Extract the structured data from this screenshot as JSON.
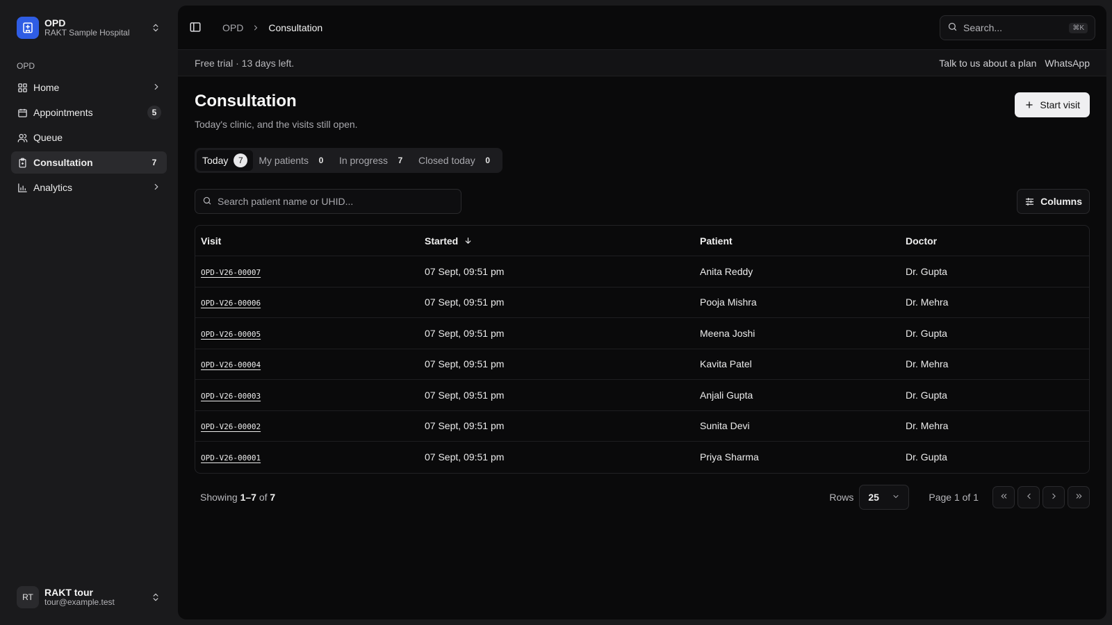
{
  "org": {
    "name": "OPD",
    "subtitle": "RAKT Sample Hospital"
  },
  "sidebar": {
    "section_label": "OPD",
    "items": [
      {
        "label": "Home",
        "icon": "grid-icon",
        "count": "",
        "chevron": true
      },
      {
        "label": "Appointments",
        "icon": "calendar-icon",
        "count": "5",
        "chevron": false
      },
      {
        "label": "Queue",
        "icon": "users-icon",
        "count": "",
        "chevron": false
      },
      {
        "label": "Consultation",
        "icon": "clipboard-icon",
        "count": "7",
        "chevron": false,
        "active": true
      },
      {
        "label": "Analytics",
        "icon": "bar-chart-icon",
        "count": "",
        "chevron": true
      }
    ]
  },
  "user": {
    "initials": "RT",
    "name": "RAKT tour",
    "email": "tour@example.test"
  },
  "breadcrumb": {
    "parent": "OPD",
    "current": "Consultation"
  },
  "search": {
    "placeholder": "Search...",
    "shortcut": "⌘K"
  },
  "trial": {
    "text": "Free trial · 13 days left.",
    "plan_link": "Talk to us about a plan",
    "whatsapp_link": "WhatsApp"
  },
  "page": {
    "title": "Consultation",
    "subtitle": "Today's clinic, and the visits still open.",
    "start_visit_label": "Start visit"
  },
  "tabs": [
    {
      "label": "Today",
      "count": "7",
      "active": true
    },
    {
      "label": "My patients",
      "count": "0"
    },
    {
      "label": "In progress",
      "count": "7"
    },
    {
      "label": "Closed today",
      "count": "0"
    }
  ],
  "table_search": {
    "placeholder": "Search patient name or UHID..."
  },
  "columns_button": "Columns",
  "table": {
    "headers": [
      "Visit",
      "Started",
      "Patient",
      "Doctor"
    ],
    "rows": [
      {
        "visit": "OPD-V26-00007",
        "started": "07 Sept, 09:51 pm",
        "patient": "Anita Reddy",
        "doctor": "Dr. Gupta"
      },
      {
        "visit": "OPD-V26-00006",
        "started": "07 Sept, 09:51 pm",
        "patient": "Pooja Mishra",
        "doctor": "Dr. Mehra"
      },
      {
        "visit": "OPD-V26-00005",
        "started": "07 Sept, 09:51 pm",
        "patient": "Meena Joshi",
        "doctor": "Dr. Gupta"
      },
      {
        "visit": "OPD-V26-00004",
        "started": "07 Sept, 09:51 pm",
        "patient": "Kavita Patel",
        "doctor": "Dr. Mehra"
      },
      {
        "visit": "OPD-V26-00003",
        "started": "07 Sept, 09:51 pm",
        "patient": "Anjali Gupta",
        "doctor": "Dr. Gupta"
      },
      {
        "visit": "OPD-V26-00002",
        "started": "07 Sept, 09:51 pm",
        "patient": "Sunita Devi",
        "doctor": "Dr. Mehra"
      },
      {
        "visit": "OPD-V26-00001",
        "started": "07 Sept, 09:51 pm",
        "patient": "Priya Sharma",
        "doctor": "Dr. Gupta"
      }
    ]
  },
  "pagination": {
    "showing_prefix": "Showing",
    "range": "1–7",
    "of_word": "of",
    "total": "7",
    "rows_label": "Rows",
    "rows_value": "25",
    "page_info": "Page 1 of 1"
  },
  "colors": {
    "accent": "#2f5de4",
    "background": "#0a0a0b",
    "sidebar": "#1a1a1c"
  }
}
